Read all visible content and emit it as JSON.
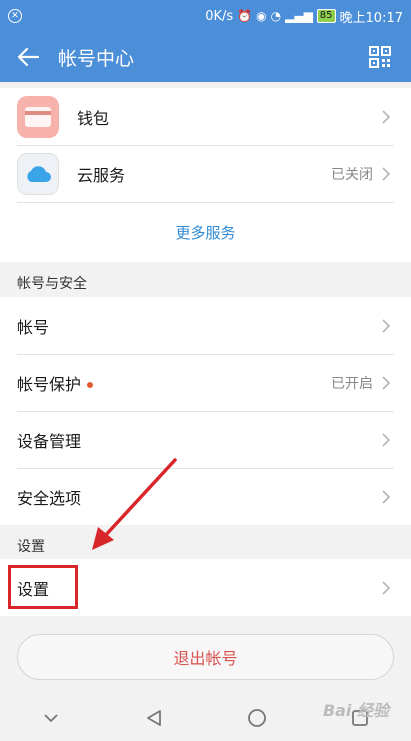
{
  "status_bar": {
    "speed": "0K/s",
    "battery": "85",
    "time": "晚上10:17"
  },
  "header": {
    "title": "帐号中心"
  },
  "services": {
    "items": [
      {
        "label": "钱包",
        "value": ""
      },
      {
        "label": "云服务",
        "value": "已关闭"
      }
    ],
    "more": "更多服务"
  },
  "account_security": {
    "title": "帐号与安全",
    "items": [
      {
        "label": "帐号",
        "value": ""
      },
      {
        "label": "帐号保护",
        "value": "已开启"
      },
      {
        "label": "设备管理",
        "value": ""
      },
      {
        "label": "安全选项",
        "value": ""
      }
    ]
  },
  "settings": {
    "title": "设置",
    "items": [
      {
        "label": "设置"
      }
    ]
  },
  "logout": {
    "label": "退出帐号"
  },
  "watermark": "Bai 经验",
  "colors": {
    "primary": "#4b8fd9",
    "link": "#2f8bd6",
    "danger": "#d9534f",
    "annotation": "#d8262a",
    "badge_dot": "#e35a2e"
  }
}
